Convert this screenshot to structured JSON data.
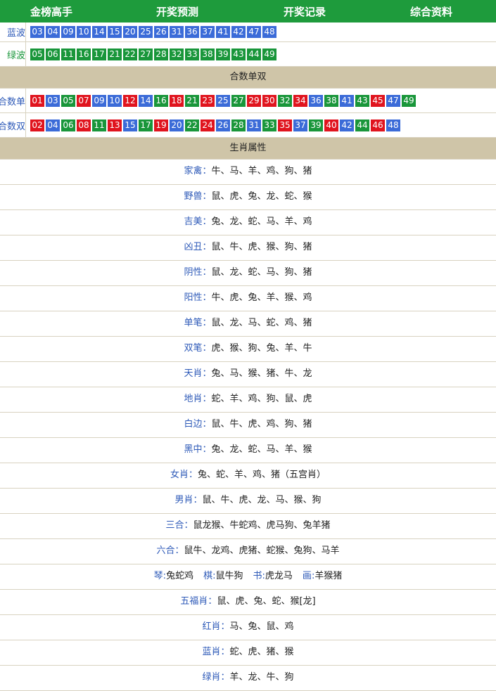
{
  "nav": [
    "金榜高手",
    "开奖预测",
    "开奖记录",
    "综合资料"
  ],
  "wave_rows": [
    {
      "label": "蓝波",
      "label_color": "#2e5ab8",
      "balls": [
        {
          "n": "03",
          "c": "blue"
        },
        {
          "n": "04",
          "c": "blue"
        },
        {
          "n": "09",
          "c": "blue"
        },
        {
          "n": "10",
          "c": "blue"
        },
        {
          "n": "14",
          "c": "blue"
        },
        {
          "n": "15",
          "c": "blue"
        },
        {
          "n": "20",
          "c": "blue"
        },
        {
          "n": "25",
          "c": "blue"
        },
        {
          "n": "26",
          "c": "blue"
        },
        {
          "n": "31",
          "c": "blue"
        },
        {
          "n": "36",
          "c": "blue"
        },
        {
          "n": "37",
          "c": "blue"
        },
        {
          "n": "41",
          "c": "blue"
        },
        {
          "n": "42",
          "c": "blue"
        },
        {
          "n": "47",
          "c": "blue"
        },
        {
          "n": "48",
          "c": "blue"
        }
      ]
    },
    {
      "label": "绿波",
      "label_color": "#19963a",
      "balls": [
        {
          "n": "05",
          "c": "green"
        },
        {
          "n": "06",
          "c": "green"
        },
        {
          "n": "11",
          "c": "green"
        },
        {
          "n": "16",
          "c": "green"
        },
        {
          "n": "17",
          "c": "green"
        },
        {
          "n": "21",
          "c": "green"
        },
        {
          "n": "22",
          "c": "green"
        },
        {
          "n": "27",
          "c": "green"
        },
        {
          "n": "28",
          "c": "green"
        },
        {
          "n": "32",
          "c": "green"
        },
        {
          "n": "33",
          "c": "green"
        },
        {
          "n": "38",
          "c": "green"
        },
        {
          "n": "39",
          "c": "green"
        },
        {
          "n": "43",
          "c": "green"
        },
        {
          "n": "44",
          "c": "green"
        },
        {
          "n": "49",
          "c": "green"
        }
      ]
    }
  ],
  "header_sum": "合数单双",
  "sum_rows": [
    {
      "label": "合数单",
      "label_color": "#2e5ab8",
      "balls": [
        {
          "n": "01",
          "c": "red"
        },
        {
          "n": "03",
          "c": "blue"
        },
        {
          "n": "05",
          "c": "green"
        },
        {
          "n": "07",
          "c": "red"
        },
        {
          "n": "09",
          "c": "blue"
        },
        {
          "n": "10",
          "c": "blue"
        },
        {
          "n": "12",
          "c": "red"
        },
        {
          "n": "14",
          "c": "blue"
        },
        {
          "n": "16",
          "c": "green"
        },
        {
          "n": "18",
          "c": "red"
        },
        {
          "n": "21",
          "c": "green"
        },
        {
          "n": "23",
          "c": "red"
        },
        {
          "n": "25",
          "c": "blue"
        },
        {
          "n": "27",
          "c": "green"
        },
        {
          "n": "29",
          "c": "red"
        },
        {
          "n": "30",
          "c": "red"
        },
        {
          "n": "32",
          "c": "green"
        },
        {
          "n": "34",
          "c": "red"
        },
        {
          "n": "36",
          "c": "blue"
        },
        {
          "n": "38",
          "c": "green"
        },
        {
          "n": "41",
          "c": "blue"
        },
        {
          "n": "43",
          "c": "green"
        },
        {
          "n": "45",
          "c": "red"
        },
        {
          "n": "47",
          "c": "blue"
        },
        {
          "n": "49",
          "c": "green"
        }
      ]
    },
    {
      "label": "合数双",
      "label_color": "#2e5ab8",
      "balls": [
        {
          "n": "02",
          "c": "red"
        },
        {
          "n": "04",
          "c": "blue"
        },
        {
          "n": "06",
          "c": "green"
        },
        {
          "n": "08",
          "c": "red"
        },
        {
          "n": "11",
          "c": "green"
        },
        {
          "n": "13",
          "c": "red"
        },
        {
          "n": "15",
          "c": "blue"
        },
        {
          "n": "17",
          "c": "green"
        },
        {
          "n": "19",
          "c": "red"
        },
        {
          "n": "20",
          "c": "blue"
        },
        {
          "n": "22",
          "c": "green"
        },
        {
          "n": "24",
          "c": "red"
        },
        {
          "n": "26",
          "c": "blue"
        },
        {
          "n": "28",
          "c": "green"
        },
        {
          "n": "31",
          "c": "blue"
        },
        {
          "n": "33",
          "c": "green"
        },
        {
          "n": "35",
          "c": "red"
        },
        {
          "n": "37",
          "c": "blue"
        },
        {
          "n": "39",
          "c": "green"
        },
        {
          "n": "40",
          "c": "red"
        },
        {
          "n": "42",
          "c": "blue"
        },
        {
          "n": "44",
          "c": "green"
        },
        {
          "n": "46",
          "c": "red"
        },
        {
          "n": "48",
          "c": "blue"
        }
      ]
    }
  ],
  "header_zodiac": "生肖属性",
  "zodiac_rows": [
    [
      {
        "k": "家禽",
        "v": "牛、马、羊、鸡、狗、猪"
      }
    ],
    [
      {
        "k": "野兽",
        "v": "鼠、虎、兔、龙、蛇、猴"
      }
    ],
    [
      {
        "k": "吉美",
        "v": "兔、龙、蛇、马、羊、鸡"
      }
    ],
    [
      {
        "k": "凶丑",
        "v": "鼠、牛、虎、猴、狗、猪"
      }
    ],
    [
      {
        "k": "阴性",
        "v": "鼠、龙、蛇、马、狗、猪"
      }
    ],
    [
      {
        "k": "阳性",
        "v": "牛、虎、兔、羊、猴、鸡"
      }
    ],
    [
      {
        "k": "单笔",
        "v": "鼠、龙、马、蛇、鸡、猪"
      }
    ],
    [
      {
        "k": "双笔",
        "v": "虎、猴、狗、兔、羊、牛"
      }
    ],
    [
      {
        "k": "天肖",
        "v": "兔、马、猴、猪、牛、龙"
      }
    ],
    [
      {
        "k": "地肖",
        "v": "蛇、羊、鸡、狗、鼠、虎"
      }
    ],
    [
      {
        "k": "白边",
        "v": "鼠、牛、虎、鸡、狗、猪"
      }
    ],
    [
      {
        "k": "黑中",
        "v": "兔、龙、蛇、马、羊、猴"
      }
    ],
    [
      {
        "k": "女肖",
        "v": "兔、蛇、羊、鸡、猪（五宫肖）"
      }
    ],
    [
      {
        "k": "男肖",
        "v": "鼠、牛、虎、龙、马、猴、狗"
      }
    ],
    [
      {
        "k": "三合",
        "v": "鼠龙猴、牛蛇鸡、虎马狗、兔羊猪"
      }
    ],
    [
      {
        "k": "六合",
        "v": "鼠牛、龙鸡、虎猪、蛇猴、兔狗、马羊"
      }
    ],
    [
      {
        "k": "琴",
        "v": "兔蛇鸡"
      },
      {
        "k": "棋",
        "v": "鼠牛狗"
      },
      {
        "k": "书",
        "v": "虎龙马"
      },
      {
        "k": "画",
        "v": "羊猴猪"
      }
    ],
    [
      {
        "k": "五福肖",
        "v": "鼠、虎、兔、蛇、猴[龙]"
      }
    ],
    [
      {
        "k": "红肖",
        "v": "马、兔、鼠、鸡"
      }
    ],
    [
      {
        "k": "蓝肖",
        "v": "蛇、虎、猪、猴"
      }
    ],
    [
      {
        "k": "绿肖",
        "v": "羊、龙、牛、狗"
      }
    ]
  ],
  "colors": {
    "nav_bg": "#1e9b3c",
    "header_bg": "#cfc5a8",
    "blue": "#3b6bd8",
    "green": "#19963a",
    "red": "#e0141e",
    "key_text": "#2e5ab8"
  }
}
